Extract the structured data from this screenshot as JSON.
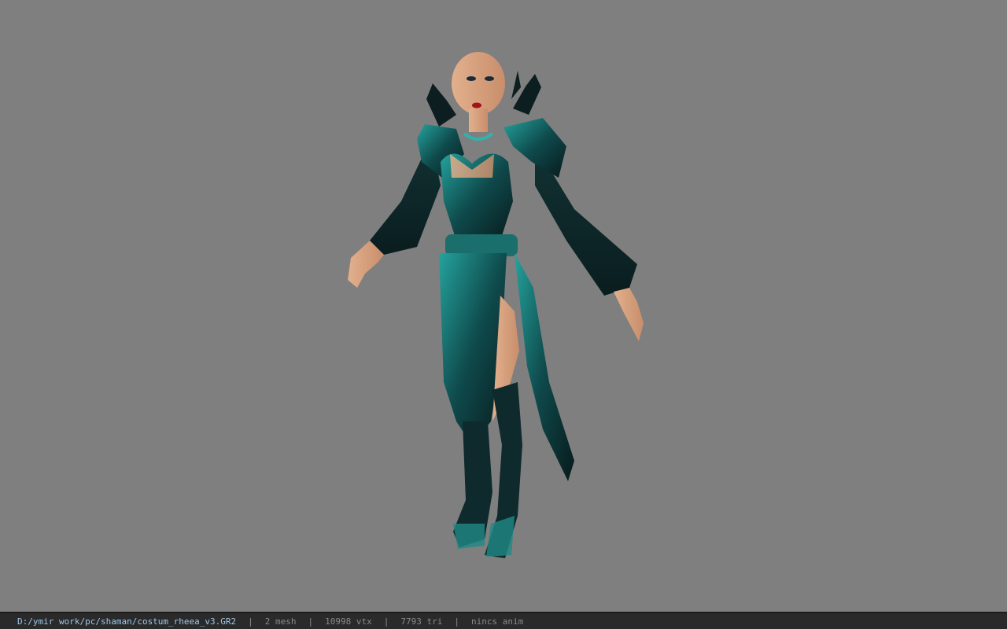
{
  "viewer": {
    "background_color": "#7f7f7f",
    "model_icon": "character-model"
  },
  "status": {
    "file_path": "D:/ymir work/pc/shaman/costum_rheea_v3.GR2",
    "separator": "|",
    "mesh": "2 mesh",
    "vtx": "10998 vtx",
    "tri": "7793 tri",
    "anim": "nincs anim"
  },
  "colors": {
    "status_bg": "#2a2a2a",
    "path_color": "#9ec7e8",
    "stat_color": "#8a8a8a",
    "armor_teal": "#1f8a86",
    "armor_dark": "#0d2326",
    "skin": "#d9a27f"
  }
}
